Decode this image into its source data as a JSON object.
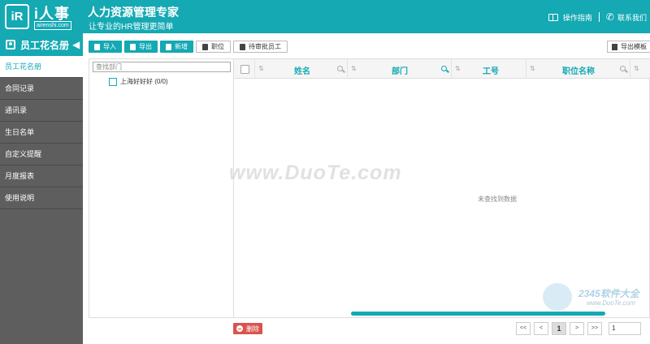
{
  "header": {
    "logo_letters": "iR",
    "logo_title": "i人事",
    "logo_url": "airenshi.com",
    "title": "人力资源管理专家",
    "subtitle": "让专业的HR管理更简单",
    "guide_label": "操作指南",
    "contact_label": "联系我们"
  },
  "sidebar": {
    "heading": "员工花名册",
    "items": [
      {
        "label": "员工花名册"
      },
      {
        "label": "合同记录"
      },
      {
        "label": "通讯录"
      },
      {
        "label": "生日名单"
      },
      {
        "label": "自定义提醒"
      },
      {
        "label": "月度报表"
      },
      {
        "label": "使用说明"
      }
    ]
  },
  "toolbar": {
    "import": "导入",
    "export": "导出",
    "add": "新增",
    "position": "职位",
    "pending": "待审批员工",
    "export_template": "导出模板"
  },
  "tree": {
    "search_placeholder": "查找部门",
    "root_node": "上海好好好 (0/0)"
  },
  "grid": {
    "columns": [
      "姓名",
      "部门",
      "工号",
      "职位名称"
    ],
    "empty_message": "未查找到数据"
  },
  "footer": {
    "delete": "删除",
    "pager": {
      "first": "<<",
      "prev": "<",
      "current": "1",
      "next": ">",
      "last": ">>",
      "page_input": "1"
    }
  },
  "watermark": {
    "text": "www.DuoTe.com",
    "corner_text": "2345软件大全",
    "corner_url": "www.DuoTe.com"
  },
  "colors": {
    "accent": "#14a9b3",
    "sidebar_bg": "#5e5e5e",
    "delete": "#d9534f"
  }
}
